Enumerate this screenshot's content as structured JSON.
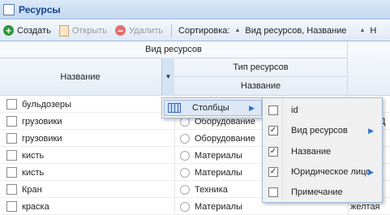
{
  "window": {
    "title": "Ресурсы"
  },
  "toolbar": {
    "create_label": "Создать",
    "open_label": "Открыть",
    "delete_label": "Удалить",
    "sort_label": "Сортировка:",
    "sort_value": "Вид ресурсов, Название",
    "sort_more": "Н"
  },
  "header": {
    "group1": "Вид ресурсов",
    "col_name": "Название",
    "group2": "Тип ресурсов",
    "col_type_name": "Название"
  },
  "rows": [
    {
      "name": "бульдозеры",
      "type": "",
      "extra": ""
    },
    {
      "name": "грузовики",
      "type": "Оборудование",
      "extra": "Д"
    },
    {
      "name": "грузовики",
      "type": "Оборудование",
      "extra": ""
    },
    {
      "name": "кисть",
      "type": "Материалы",
      "extra": ""
    },
    {
      "name": "кисть",
      "type": "Материалы",
      "extra": ""
    },
    {
      "name": "Кран",
      "type": "Техника",
      "extra": ""
    },
    {
      "name": "краска",
      "type": "Материалы",
      "extra": "желтая"
    }
  ],
  "menu": {
    "columns_label": "Столбцы",
    "column_items": [
      {
        "label": "id",
        "checked": false,
        "submenu": false
      },
      {
        "label": "Вид ресурсов",
        "checked": true,
        "submenu": true
      },
      {
        "label": "Название",
        "checked": true,
        "submenu": false
      },
      {
        "label": "Юридическое лицо",
        "checked": true,
        "submenu": true
      },
      {
        "label": "Примечание",
        "checked": false,
        "submenu": false
      }
    ]
  },
  "colors": {
    "accent": "#15428b",
    "header_bg": "#dbe8f7",
    "menu_hover": "#dce8f6"
  }
}
